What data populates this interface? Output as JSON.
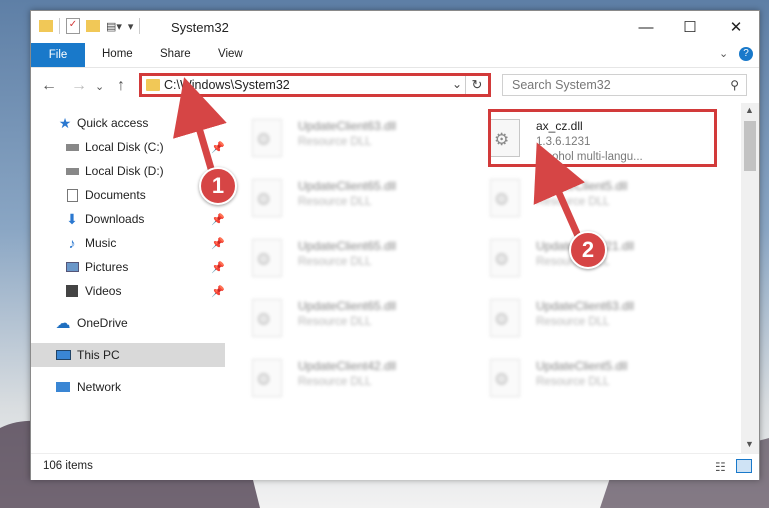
{
  "window": {
    "title": "System32"
  },
  "ribbon": {
    "tabs": [
      "File",
      "Home",
      "Share",
      "View"
    ]
  },
  "address": {
    "path": "C:\\Windows\\System32"
  },
  "search": {
    "placeholder": "Search System32"
  },
  "sidebar": {
    "items": [
      {
        "label": "Quick access",
        "icon": "star-icon"
      },
      {
        "label": "Local Disk (C:)",
        "icon": "drive-icon"
      },
      {
        "label": "Local Disk (D:)",
        "icon": "drive-icon"
      },
      {
        "label": "Documents",
        "icon": "documents-icon"
      },
      {
        "label": "Downloads",
        "icon": "download-icon"
      },
      {
        "label": "Music",
        "icon": "music-icon"
      },
      {
        "label": "Pictures",
        "icon": "pictures-icon"
      },
      {
        "label": "Videos",
        "icon": "videos-icon"
      },
      {
        "label": "OneDrive",
        "icon": "cloud-icon"
      },
      {
        "label": "This PC",
        "icon": "pc-icon"
      },
      {
        "label": "Network",
        "icon": "network-icon"
      }
    ]
  },
  "files": {
    "highlighted": {
      "name": "ax_cz.dll",
      "version": "1.3.6.1231",
      "description": "Alcohol multi-langu..."
    },
    "blurred": [
      {
        "name": "UpdateClient63.dll",
        "desc": "Resource DLL"
      },
      {
        "name": "UpdateClient65.dll",
        "desc": "Resource DLL"
      },
      {
        "name": "UpdateClient5.dll",
        "desc": "Resource DLL"
      },
      {
        "name": "UpdateClient65.dll",
        "desc": "Resource DLL"
      },
      {
        "name": "UpdateClient21.dll",
        "desc": "Resource DLL"
      },
      {
        "name": "UpdateClient65.dll",
        "desc": "Resource DLL"
      },
      {
        "name": "UpdateClient63.dll",
        "desc": "Resource DLL"
      },
      {
        "name": "UpdateClient42.dll",
        "desc": "Resource DLL"
      },
      {
        "name": "UpdateClient5.dll",
        "desc": "Resource DLL"
      }
    ]
  },
  "status": {
    "count": "106 items"
  },
  "annotations": {
    "badge1": "1",
    "badge2": "2",
    "color": "#d23a3a"
  }
}
